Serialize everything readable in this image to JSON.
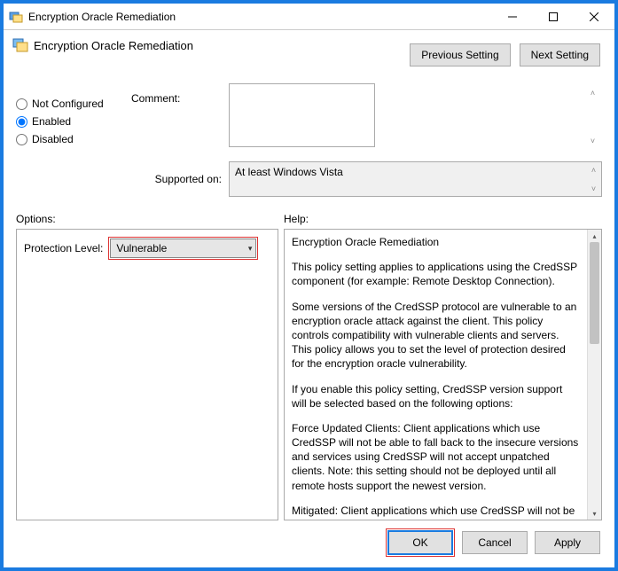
{
  "window": {
    "title": "Encryption Oracle Remediation",
    "minimize": "–",
    "maximize": "□",
    "close": "✕"
  },
  "header": {
    "title": "Encryption Oracle Remediation"
  },
  "nav": {
    "prev": "Previous Setting",
    "next": "Next Setting"
  },
  "state": {
    "not_configured": "Not Configured",
    "enabled": "Enabled",
    "disabled": "Disabled",
    "selected": "enabled"
  },
  "labels": {
    "comment": "Comment:",
    "supported_on": "Supported on:",
    "options": "Options:",
    "help": "Help:",
    "protection_level": "Protection Level:"
  },
  "supported_text": "At least Windows Vista",
  "combo": {
    "value": "Vulnerable"
  },
  "help_paragraphs": {
    "p1": "Encryption Oracle Remediation",
    "p2": "This policy setting applies to applications using the CredSSP component (for example: Remote Desktop Connection).",
    "p3": "Some versions of the CredSSP protocol are vulnerable to an encryption oracle attack against the client.  This policy controls compatibility with vulnerable clients and servers.  This policy allows you to set the level of protection desired for the encryption oracle vulnerability.",
    "p4": "If you enable this policy setting, CredSSP version support will be selected based on the following options:",
    "p5": "Force Updated Clients: Client applications which use CredSSP will not be able to fall back to the insecure versions and services using CredSSP will not accept unpatched clients. Note: this setting should not be deployed until all remote hosts support the newest version.",
    "p6": "Mitigated: Client applications which use CredSSP will not be able"
  },
  "footer": {
    "ok": "OK",
    "cancel": "Cancel",
    "apply": "Apply"
  }
}
